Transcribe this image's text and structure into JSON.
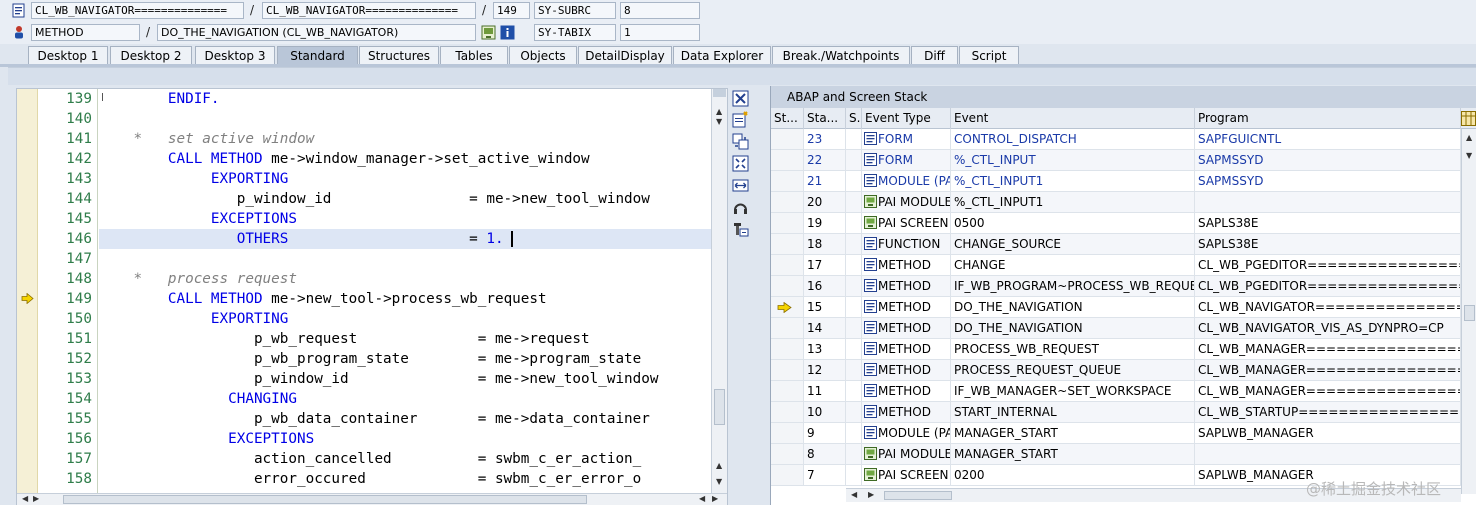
{
  "info": {
    "row1": {
      "class1": "CL_WB_NAVIGATOR==============",
      "class2": "CL_WB_NAVIGATOR==============",
      "line": "149",
      "var_name": "SY-SUBRC",
      "var_value": "8"
    },
    "row2": {
      "kind": "METHOD",
      "name": "DO_THE_NAVIGATION (CL_WB_NAVIGATOR)",
      "var_name": "SY-TABIX",
      "var_value": "1"
    },
    "slash": "/"
  },
  "tabs": [
    {
      "label": "Desktop 1"
    },
    {
      "label": "Desktop 2"
    },
    {
      "label": "Desktop 3"
    },
    {
      "label": "Standard",
      "active": true
    },
    {
      "label": "Structures"
    },
    {
      "label": "Tables"
    },
    {
      "label": "Objects"
    },
    {
      "label": "DetailDisplay"
    },
    {
      "label": "Data Explorer"
    },
    {
      "label": "Break./Watchpoints"
    },
    {
      "label": "Diff"
    },
    {
      "label": "Script"
    }
  ],
  "editor": {
    "current_line": "149",
    "highlight_line": "146",
    "lines": [
      {
        "num": "139",
        "parts": [
          {
            "t": "    ",
            "c": ""
          },
          {
            "t": "ENDIF.",
            "c": "kw"
          }
        ]
      },
      {
        "num": "140",
        "parts": []
      },
      {
        "num": "141",
        "parts": [
          {
            "t": "*   set active window",
            "c": "cm"
          }
        ]
      },
      {
        "num": "142",
        "parts": [
          {
            "t": "    ",
            "c": ""
          },
          {
            "t": "CALL METHOD",
            "c": "kw"
          },
          {
            "t": " me->window_manager->set_active_window",
            "c": ""
          }
        ]
      },
      {
        "num": "143",
        "parts": [
          {
            "t": "         ",
            "c": ""
          },
          {
            "t": "EXPORTING",
            "c": "kw"
          }
        ]
      },
      {
        "num": "144",
        "parts": [
          {
            "t": "            p_window_id                = me->new_tool_window",
            "c": ""
          }
        ]
      },
      {
        "num": "145",
        "parts": [
          {
            "t": "         ",
            "c": ""
          },
          {
            "t": "EXCEPTIONS",
            "c": "kw"
          }
        ]
      },
      {
        "num": "146",
        "parts": [
          {
            "t": "            ",
            "c": ""
          },
          {
            "t": "OTHERS",
            "c": "kw"
          },
          {
            "t": "                     = ",
            "c": ""
          },
          {
            "t": "1.",
            "c": "num"
          }
        ]
      },
      {
        "num": "147",
        "parts": []
      },
      {
        "num": "148",
        "parts": [
          {
            "t": "*   process request",
            "c": "cm"
          }
        ]
      },
      {
        "num": "149",
        "parts": [
          {
            "t": "    ",
            "c": ""
          },
          {
            "t": "CALL METHOD",
            "c": "kw"
          },
          {
            "t": " me->new_tool->process_wb_request",
            "c": ""
          }
        ]
      },
      {
        "num": "150",
        "parts": [
          {
            "t": "         ",
            "c": ""
          },
          {
            "t": "EXPORTING",
            "c": "kw"
          }
        ]
      },
      {
        "num": "151",
        "parts": [
          {
            "t": "              p_wb_request              = me->request",
            "c": ""
          }
        ]
      },
      {
        "num": "152",
        "parts": [
          {
            "t": "              p_wb_program_state        = me->program_state",
            "c": ""
          }
        ]
      },
      {
        "num": "153",
        "parts": [
          {
            "t": "              p_window_id               = me->new_tool_window",
            "c": ""
          }
        ]
      },
      {
        "num": "154",
        "parts": [
          {
            "t": "           ",
            "c": ""
          },
          {
            "t": "CHANGING",
            "c": "kw"
          }
        ]
      },
      {
        "num": "155",
        "parts": [
          {
            "t": "              p_wb_data_container       = me->data_container",
            "c": ""
          }
        ]
      },
      {
        "num": "156",
        "parts": [
          {
            "t": "           ",
            "c": ""
          },
          {
            "t": "EXCEPTIONS",
            "c": "kw"
          }
        ]
      },
      {
        "num": "157",
        "parts": [
          {
            "t": "              action_cancelled          = swbm_c_er_action_",
            "c": ""
          }
        ]
      },
      {
        "num": "158",
        "parts": [
          {
            "t": "              error_occured             = swbm_c_er_error_o",
            "c": ""
          }
        ]
      }
    ]
  },
  "stack": {
    "title": "ABAP and Screen Stack",
    "columns": {
      "st": "St...",
      "sta": "Sta...",
      "s": "S...",
      "type": "Event Type",
      "event": "Event",
      "program": "Program"
    },
    "current_level": "15",
    "rows": [
      {
        "level": "23",
        "type": "FORM",
        "event": "CONTROL_DISPATCH",
        "program": "SAPFGUICNTL",
        "icon": "abap",
        "blue": true
      },
      {
        "level": "22",
        "type": "FORM",
        "event": "%_CTL_INPUT",
        "program": "SAPMSSYD",
        "icon": "abap",
        "blue": true
      },
      {
        "level": "21",
        "type": "MODULE (PAI)",
        "event": "%_CTL_INPUT1",
        "program": "SAPMSSYD",
        "icon": "abap",
        "blue": true
      },
      {
        "level": "20",
        "type": "PAI MODULE",
        "event": "%_CTL_INPUT1",
        "program": "",
        "icon": "screen",
        "blue": false
      },
      {
        "level": "19",
        "type": "PAI SCREEN",
        "event": "0500",
        "program": "SAPLS38E",
        "icon": "screen",
        "blue": false
      },
      {
        "level": "18",
        "type": "FUNCTION",
        "event": "CHANGE_SOURCE",
        "program": "SAPLS38E",
        "icon": "abap",
        "blue": false
      },
      {
        "level": "17",
        "type": "METHOD",
        "event": "CHANGE",
        "program": "CL_WB_PGEDITOR================CP",
        "icon": "abap",
        "blue": false
      },
      {
        "level": "16",
        "type": "METHOD",
        "event": "IF_WB_PROGRAM~PROCESS_WB_REQUES...",
        "program": "CL_WB_PGEDITOR================CP",
        "icon": "abap",
        "blue": false
      },
      {
        "level": "15",
        "type": "METHOD",
        "event": "DO_THE_NAVIGATION",
        "program": "CL_WB_NAVIGATOR===============CP",
        "icon": "abap",
        "blue": false
      },
      {
        "level": "14",
        "type": "METHOD",
        "event": "DO_THE_NAVIGATION",
        "program": "CL_WB_NAVIGATOR_VIS_AS_DYNPRO=CP",
        "icon": "abap",
        "blue": false
      },
      {
        "level": "13",
        "type": "METHOD",
        "event": "PROCESS_WB_REQUEST",
        "program": "CL_WB_MANAGER=================CP",
        "icon": "abap",
        "blue": false
      },
      {
        "level": "12",
        "type": "METHOD",
        "event": "PROCESS_REQUEST_QUEUE",
        "program": "CL_WB_MANAGER=================CP",
        "icon": "abap",
        "blue": false
      },
      {
        "level": "11",
        "type": "METHOD",
        "event": "IF_WB_MANAGER~SET_WORKSPACE",
        "program": "CL_WB_MANAGER=================CP",
        "icon": "abap",
        "blue": false
      },
      {
        "level": "10",
        "type": "METHOD",
        "event": "START_INTERNAL",
        "program": "CL_WB_STARTUP=================CP",
        "icon": "abap",
        "blue": false
      },
      {
        "level": "9",
        "type": "MODULE (PAI)",
        "event": "MANAGER_START",
        "program": "SAPLWB_MANAGER",
        "icon": "abap",
        "blue": false
      },
      {
        "level": "8",
        "type": "PAI MODULE",
        "event": "MANAGER_START",
        "program": "",
        "icon": "screen",
        "blue": false
      },
      {
        "level": "7",
        "type": "PAI SCREEN",
        "event": "0200",
        "program": "SAPLWB_MANAGER",
        "icon": "screen",
        "blue": false
      }
    ]
  },
  "watermark": "@稀土掘金技术社区"
}
